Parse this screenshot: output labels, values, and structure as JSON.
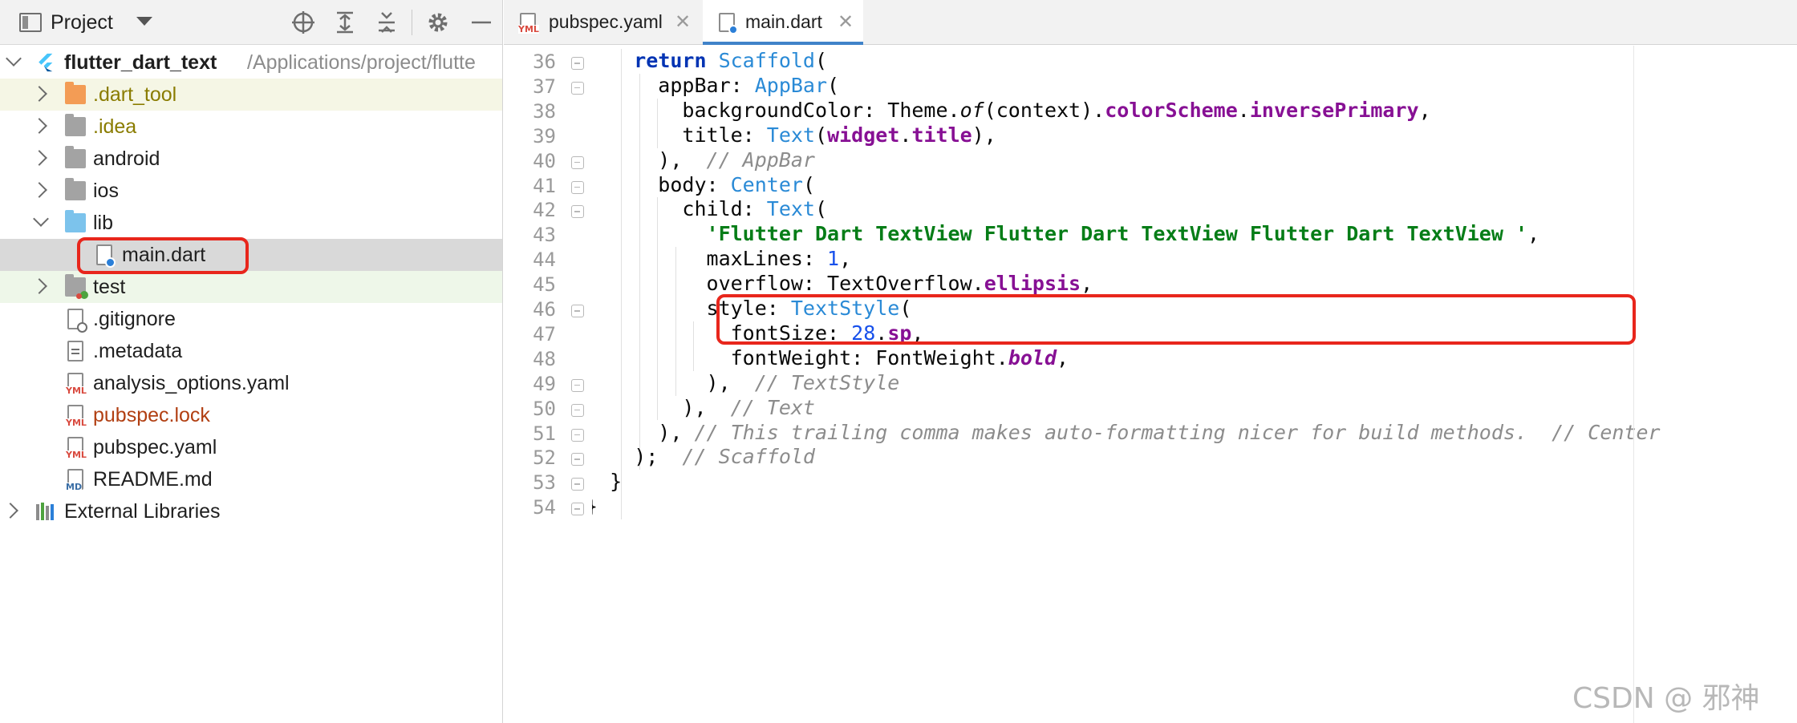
{
  "project_panel": {
    "title": "Project",
    "tree": [
      {
        "label": "flutter_dart_text",
        "path": "/Applications/project/flutte",
        "kind": "root",
        "icon": "flutter-icon",
        "expanded": true
      },
      {
        "label": ".dart_tool",
        "kind": "folder",
        "icon": "folder-orange-icon",
        "expanded": false,
        "color": "#8a7c00"
      },
      {
        "label": ".idea",
        "kind": "folder",
        "icon": "folder-settings-icon",
        "expanded": false,
        "color": "#8a7c00"
      },
      {
        "label": "android",
        "kind": "folder",
        "icon": "folder-icon",
        "expanded": false
      },
      {
        "label": "ios",
        "kind": "folder",
        "icon": "folder-icon",
        "expanded": false
      },
      {
        "label": "lib",
        "kind": "folder",
        "icon": "folder-blue-icon",
        "expanded": true
      },
      {
        "label": "main.dart",
        "kind": "file",
        "icon": "dart-file-icon",
        "selected": true
      },
      {
        "label": "test",
        "kind": "folder",
        "icon": "folder-test-icon",
        "expanded": false
      },
      {
        "label": ".gitignore",
        "kind": "file",
        "icon": "gitignore-file-icon"
      },
      {
        "label": ".metadata",
        "kind": "file",
        "icon": "text-file-icon"
      },
      {
        "label": "analysis_options.yaml",
        "kind": "file",
        "icon": "yaml-file-icon"
      },
      {
        "label": "pubspec.lock",
        "kind": "file",
        "icon": "yaml-file-icon",
        "color": "#b13f12"
      },
      {
        "label": "pubspec.yaml",
        "kind": "file",
        "icon": "yaml-file-icon"
      },
      {
        "label": "README.md",
        "kind": "file",
        "icon": "markdown-file-icon"
      },
      {
        "label": "External Libraries",
        "kind": "library",
        "icon": "libraries-icon",
        "expanded": false
      }
    ],
    "yml_tag": "YML",
    "md_tag": "MD"
  },
  "tabs": [
    {
      "label": "pubspec.yaml",
      "active": false
    },
    {
      "label": "main.dart",
      "active": true
    }
  ],
  "editor": {
    "lines": [
      {
        "n": "36",
        "segs": [
          [
            "plain",
            "    "
          ],
          [
            "kw",
            "return "
          ],
          [
            "cls",
            "Scaffold"
          ],
          [
            "plain",
            "("
          ]
        ]
      },
      {
        "n": "37",
        "segs": [
          [
            "plain",
            "      appBar: "
          ],
          [
            "cls",
            "AppBar"
          ],
          [
            "plain",
            "("
          ]
        ]
      },
      {
        "n": "38",
        "segs": [
          [
            "plain",
            "        backgroundColor: Theme."
          ],
          [
            "ital",
            "of"
          ],
          [
            "plain",
            "(context)."
          ],
          [
            "prop",
            "colorScheme"
          ],
          [
            "plain",
            "."
          ],
          [
            "prop",
            "inversePrimary"
          ],
          [
            "plain",
            ","
          ]
        ]
      },
      {
        "n": "39",
        "segs": [
          [
            "plain",
            "        title: "
          ],
          [
            "cls",
            "Text"
          ],
          [
            "plain",
            "("
          ],
          [
            "prop",
            "widget"
          ],
          [
            "plain",
            "."
          ],
          [
            "prop",
            "title"
          ],
          [
            "plain",
            "),"
          ]
        ]
      },
      {
        "n": "40",
        "segs": [
          [
            "plain",
            "      ),  "
          ],
          [
            "cmt",
            "// AppBar"
          ]
        ]
      },
      {
        "n": "41",
        "segs": [
          [
            "plain",
            "      body: "
          ],
          [
            "cls",
            "Center"
          ],
          [
            "plain",
            "("
          ]
        ]
      },
      {
        "n": "42",
        "segs": [
          [
            "plain",
            "        child: "
          ],
          [
            "cls",
            "Text"
          ],
          [
            "plain",
            "("
          ]
        ]
      },
      {
        "n": "43",
        "segs": [
          [
            "plain",
            "          "
          ],
          [
            "str",
            "'Flutter Dart TextView Flutter Dart TextView Flutter Dart TextView '"
          ],
          [
            "plain",
            ","
          ]
        ]
      },
      {
        "n": "44",
        "segs": [
          [
            "plain",
            "          maxLines: "
          ],
          [
            "num",
            "1"
          ],
          [
            "plain",
            ","
          ]
        ]
      },
      {
        "n": "45",
        "segs": [
          [
            "plain",
            "          overflow: TextOverflow."
          ],
          [
            "prop",
            "ellipsis"
          ],
          [
            "plain",
            ","
          ]
        ]
      },
      {
        "n": "46",
        "segs": [
          [
            "plain",
            "          style: "
          ],
          [
            "cls",
            "TextStyle"
          ],
          [
            "plain",
            "("
          ]
        ]
      },
      {
        "n": "47",
        "segs": [
          [
            "plain",
            "            fontSize: "
          ],
          [
            "num",
            "28"
          ],
          [
            "plain",
            "."
          ],
          [
            "prop",
            "sp"
          ],
          [
            "plain",
            ","
          ]
        ]
      },
      {
        "n": "48",
        "segs": [
          [
            "plain",
            "            fontWeight: FontWeight."
          ],
          [
            "boldital",
            "bold"
          ],
          [
            "plain",
            ","
          ]
        ]
      },
      {
        "n": "49",
        "segs": [
          [
            "plain",
            "          ),  "
          ],
          [
            "cmt",
            "// TextStyle"
          ]
        ]
      },
      {
        "n": "50",
        "segs": [
          [
            "plain",
            "        ),  "
          ],
          [
            "cmt",
            "// Text"
          ]
        ]
      },
      {
        "n": "51",
        "segs": [
          [
            "plain",
            "      ), "
          ],
          [
            "cmt",
            "// This trailing comma makes auto-formatting nicer for build methods.  // Center"
          ]
        ]
      },
      {
        "n": "52",
        "segs": [
          [
            "plain",
            "    );  "
          ],
          [
            "cmt",
            "// Scaffold"
          ]
        ]
      },
      {
        "n": "53",
        "segs": [
          [
            "plain",
            "  }"
          ]
        ]
      },
      {
        "n": "54",
        "segs": [
          [
            "plain",
            "}"
          ]
        ]
      }
    ]
  },
  "watermark": "CSDN @  邪神",
  "colors": {
    "accent": "#4083c9",
    "highlight_box": "#e8261c",
    "string": "#067d17",
    "keyword": "#0033b3",
    "class": "#2a8ad6",
    "field": "#871094",
    "comment": "#8c8c8c"
  }
}
